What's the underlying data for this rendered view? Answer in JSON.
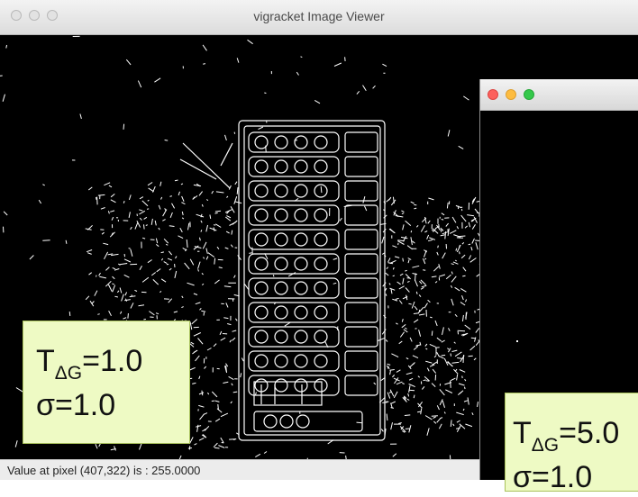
{
  "main_window": {
    "title": "vigracket Image Viewer",
    "status_text": "Value at pixel (407,322) is : 255.0000",
    "overlay": {
      "t_prefix": "T",
      "t_subscript": "ΔG",
      "t_value": "=1.0",
      "sigma_text": "σ=1.0"
    }
  },
  "second_window": {
    "title": "",
    "overlay": {
      "t_prefix": "T",
      "t_subscript": "ΔG",
      "t_value": "=5.0",
      "sigma_text": "σ=1.0"
    }
  },
  "colors": {
    "overlay_fill": "#eefac4",
    "overlay_border": "#a9c25c",
    "traffic_close": "#fc605c",
    "traffic_minimize": "#fdbc40",
    "traffic_zoom": "#34c84a"
  },
  "icons": [
    "close-button-icon",
    "minimize-button-icon",
    "zoom-button-icon"
  ]
}
